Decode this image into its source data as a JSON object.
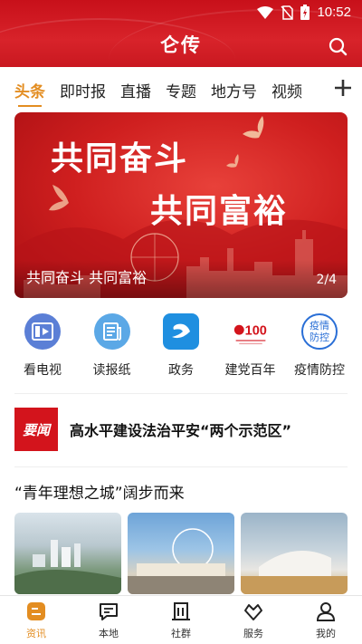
{
  "status_bar": {
    "time": "10:52"
  },
  "header": {
    "title": "仑传"
  },
  "tabs": [
    {
      "label": "头条",
      "active": true
    },
    {
      "label": "即时报"
    },
    {
      "label": "直播"
    },
    {
      "label": "专题"
    },
    {
      "label": "地方号"
    },
    {
      "label": "视频"
    }
  ],
  "banner": {
    "headline_line1": "共同奋斗",
    "headline_line2": "共同富裕",
    "caption": "共同奋斗 共同富裕",
    "pager": "2/4"
  },
  "quick_links": [
    {
      "label": "看电视",
      "icon": "tv-icon"
    },
    {
      "label": "读报纸",
      "icon": "newspaper-icon"
    },
    {
      "label": "政务",
      "icon": "government-icon"
    },
    {
      "label": "建党百年",
      "icon": "party-centenary-icon"
    },
    {
      "label": "疫情防控",
      "icon": "epidemic-control-icon",
      "icon_text_1": "疫情",
      "icon_text_2": "防控"
    }
  ],
  "news": {
    "badge": "要闻",
    "title": "高水平建设法治平安“两个示范区”"
  },
  "section": {
    "title": "“青年理想之城”阔步而来"
  },
  "bottom_nav": [
    {
      "label": "资讯",
      "icon": "news-icon",
      "active": true
    },
    {
      "label": "本地",
      "icon": "chat-bubble-icon"
    },
    {
      "label": "社群",
      "icon": "community-icon"
    },
    {
      "label": "服务",
      "icon": "service-icon"
    },
    {
      "label": "我的",
      "icon": "profile-icon"
    }
  ],
  "colors": {
    "brand_red": "#d3141c",
    "accent_orange": "#e38d21"
  }
}
